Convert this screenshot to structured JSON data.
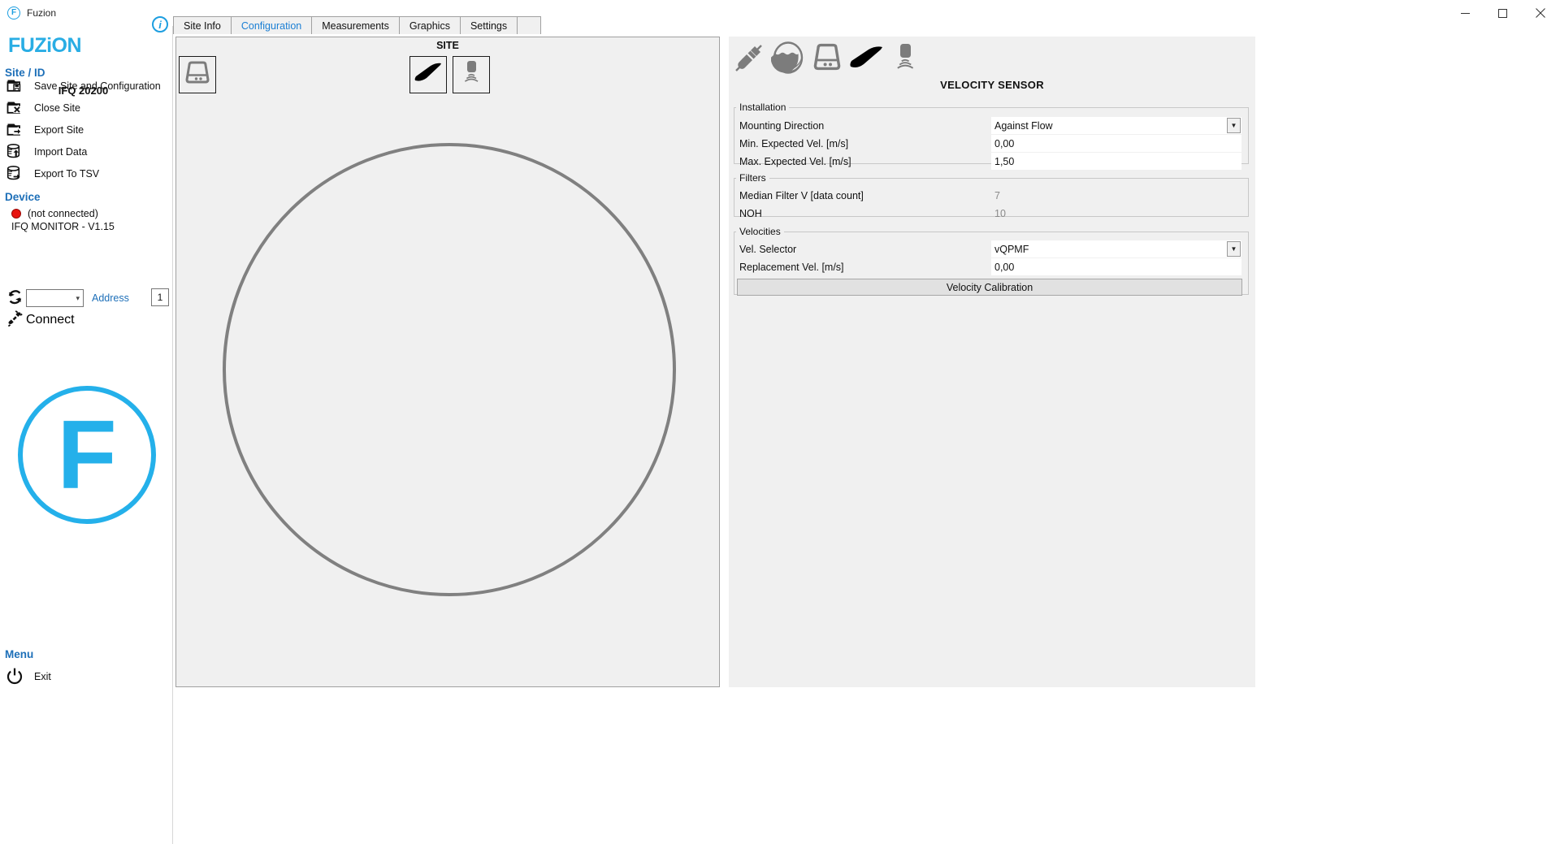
{
  "window": {
    "title": "Fuzion",
    "app_icon": "fuzion-logo-icon",
    "minimize": "minimize-icon",
    "maximize": "maximize-icon",
    "close": "close-icon"
  },
  "sidebar": {
    "brand": "FUZiON",
    "site_section_label": "Site / ID",
    "site_id": "IFQ 20200",
    "menu_items": [
      {
        "label": "Save Site and Configuration",
        "icon": "folder-save-icon"
      },
      {
        "label": "Close Site",
        "icon": "folder-close-icon"
      },
      {
        "label": "Export Site",
        "icon": "folder-export-icon"
      },
      {
        "label": "Import Data",
        "icon": "database-import-icon"
      },
      {
        "label": "Export To TSV",
        "icon": "database-export-icon"
      }
    ],
    "device_section_label": "Device",
    "device_status": "(not connected)",
    "device_status_color": "#e8130f",
    "device_name": "IFQ MONITOR - V1.15",
    "address_dropdown_value": "",
    "address_label": "Address",
    "address_number": "1",
    "refresh_icon": "refresh-icon",
    "connect_label": "Connect",
    "connect_icon": "plug-connect-icon",
    "menu_section_label": "Menu",
    "exit_label": "Exit",
    "exit_icon": "power-icon",
    "logo_letter": "F",
    "accent_color": "#24b0ea"
  },
  "tabs": {
    "info_badge": "i",
    "items": [
      {
        "label": "Site Info",
        "active": false
      },
      {
        "label": "Configuration",
        "active": true
      },
      {
        "label": "Measurements",
        "active": false
      },
      {
        "label": "Graphics",
        "active": false
      },
      {
        "label": "Settings",
        "active": false
      }
    ],
    "active_color": "#1b7fd4"
  },
  "site_panel": {
    "title": "SITE",
    "device_icon": "monitor-device-icon",
    "velocity_sensor_icon": "velocity-wedge-icon",
    "level_sensor_icon": "level-sonar-icon",
    "pipe_shape": "circular-pipe-outline"
  },
  "config_panel": {
    "toolbar_icons": [
      "connector-plug-icon",
      "pipe-water-icon",
      "monitor-device-icon",
      "velocity-wedge-icon",
      "level-sonar-icon"
    ],
    "title": "VELOCITY SENSOR",
    "groups": [
      {
        "legend": "Installation",
        "rows": [
          {
            "label": "Mounting Direction",
            "value": "Against Flow",
            "type": "dropdown"
          },
          {
            "label": "Min. Expected Vel. [m/s]",
            "value": "0,00",
            "type": "input"
          },
          {
            "label": "Max. Expected Vel. [m/s]",
            "value": "1,50",
            "type": "input"
          }
        ]
      },
      {
        "legend": "Filters",
        "rows": [
          {
            "label": "Median Filter V [data count]",
            "value": "7",
            "type": "readonly"
          },
          {
            "label": "NOH",
            "value": "10",
            "type": "readonly"
          }
        ]
      },
      {
        "legend": "Velocities",
        "rows": [
          {
            "label": "Vel. Selector",
            "value": "vQPMF",
            "type": "dropdown"
          },
          {
            "label": "Replacement Vel. [m/s]",
            "value": "0,00",
            "type": "input"
          }
        ],
        "button": "Velocity Calibration"
      }
    ]
  }
}
